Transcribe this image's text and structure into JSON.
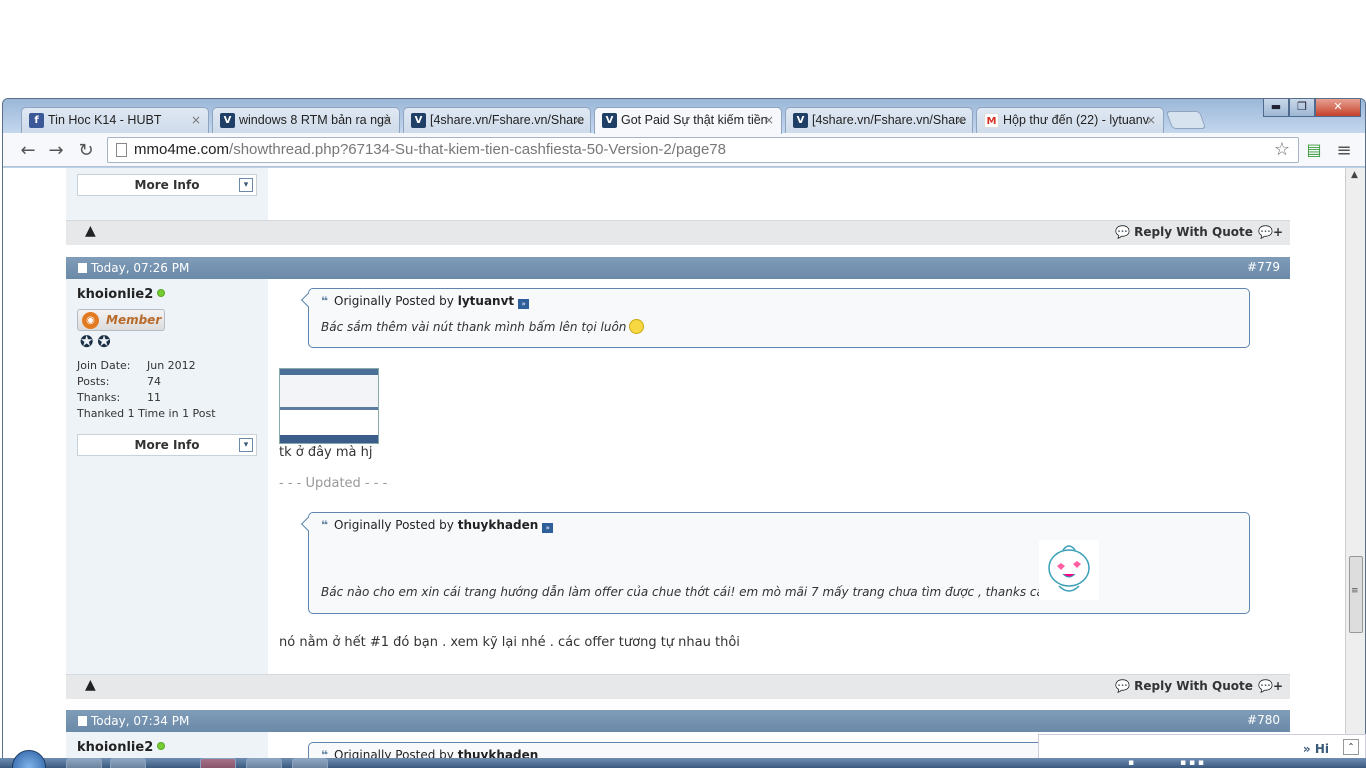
{
  "browser": {
    "tabs": [
      {
        "label": "Tin Hoc K14 - HUBT",
        "icon": "facebook-icon",
        "icon_color": "#3b5998"
      },
      {
        "label": "windows 8 RTM bản ra ngà",
        "icon": "mmo4me-icon",
        "icon_color": "#1f3f66"
      },
      {
        "label": "[4share.vn/Fshare.vn/Share",
        "icon": "mmo4me-icon",
        "icon_color": "#1f3f66"
      },
      {
        "label": "Got Paid Sự thật kiếm tiền",
        "icon": "mmo4me-icon",
        "icon_color": "#1f3f66",
        "active": true
      },
      {
        "label": "[4share.vn/Fshare.vn/Share",
        "icon": "mmo4me-icon",
        "icon_color": "#1f3f66"
      },
      {
        "label": "Hộp thư đến (22) - lytuanv",
        "icon": "gmail-icon",
        "icon_color": "#d93025"
      }
    ],
    "close_glyph": "×",
    "url_host": "mmo4me.com",
    "url_path": "/showthread.php?67134-Su-that-kiem-tien-cashfiesta-50-Version-2/page78"
  },
  "forum": {
    "more_info_label": "More Info",
    "reply_with_quote_label": "Reply With Quote",
    "multi_quote_glyph": "💬+",
    "posts": [
      {
        "date": "Today, 07:26 PM",
        "number": "#779",
        "username": "khoionlie2",
        "rank": "Member",
        "stats": [
          {
            "key": "Join Date:",
            "value": "Jun 2012"
          },
          {
            "key": "Posts:",
            "value": "74"
          },
          {
            "key": "Thanks:",
            "value": "11"
          },
          {
            "key": "",
            "value": "Thanked 1 Time in 1 Post"
          }
        ],
        "quote1_prefix": "Originally Posted by",
        "quote1_author": "lytuanvt",
        "quote1_text": "Bác sắm thêm vài nút thank mình bấm lên tọi luôn",
        "text1": "tk ở đây mà hj",
        "updated_label": "- - - Updated - - -",
        "quote2_prefix": "Originally Posted by",
        "quote2_author": "thuykhaden",
        "quote2_text": "Bác nào cho em xin cái trang hướng dẫn làm offer của chue thớt cái! em mò mãi 7 mấy trang chưa tìm được , thanks các bác!",
        "text2": "nó nằm ở hết #1 đó bạn . xem kỹ lại nhé . các offer tương tự nhau thôi"
      },
      {
        "date": "Today, 07:34 PM",
        "number": "#780",
        "username": "khoionlie2",
        "quote_prefix": "Originally Posted by",
        "quote_author": "thuykhaden"
      }
    ]
  },
  "chat": {
    "label": "Hi"
  }
}
